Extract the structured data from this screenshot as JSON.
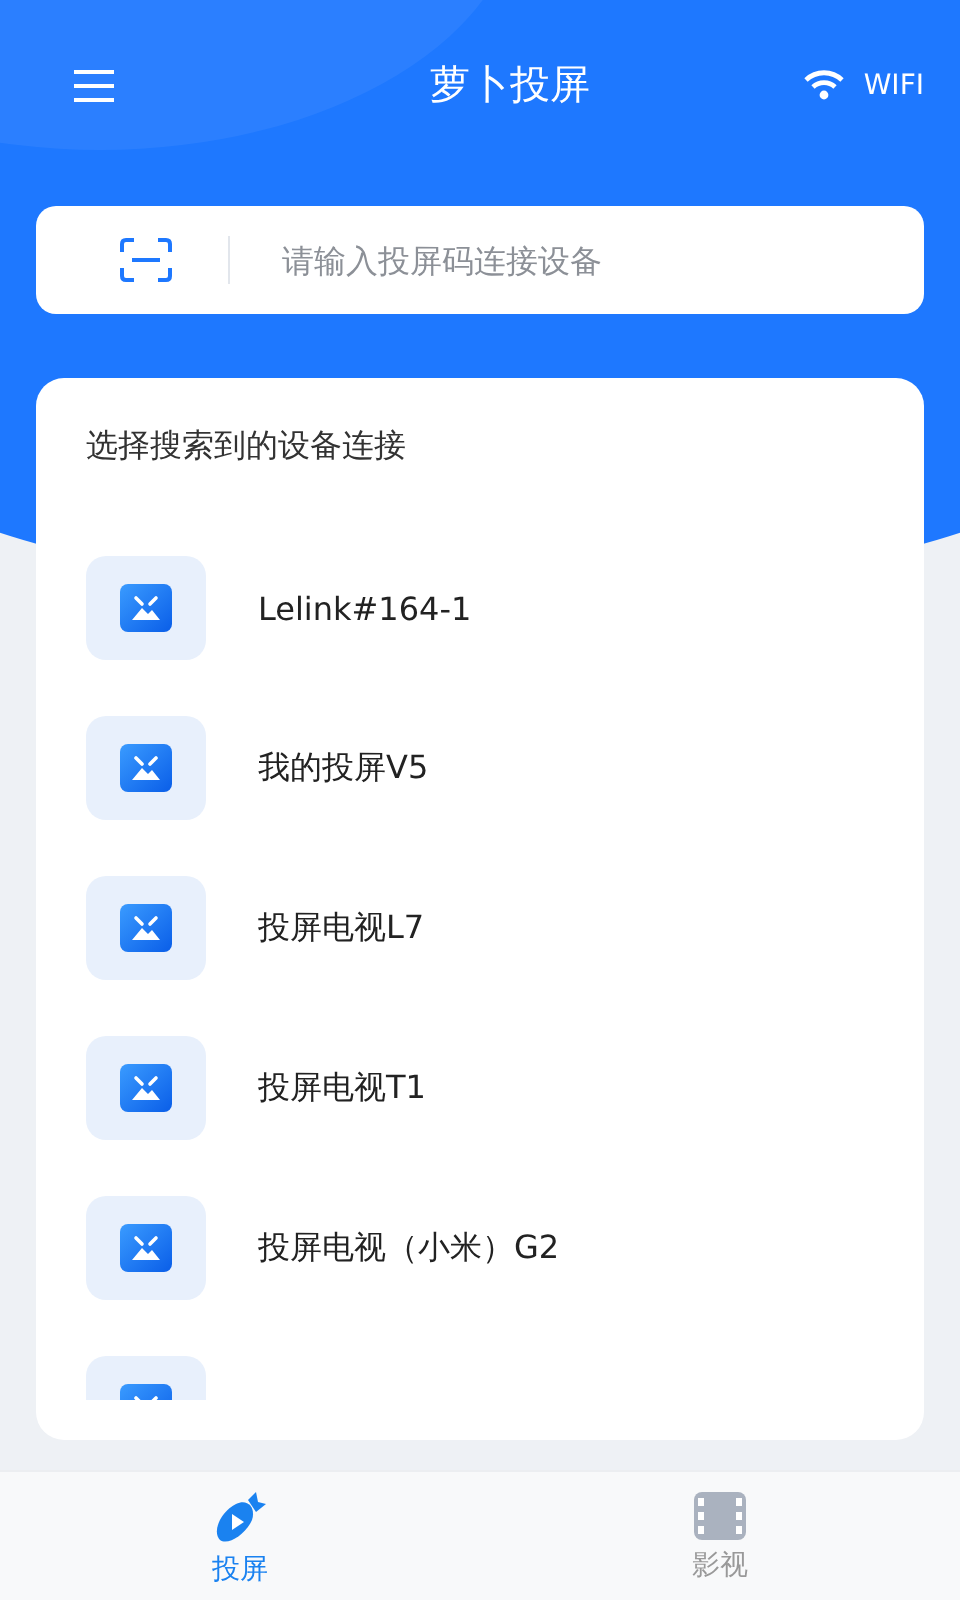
{
  "header": {
    "title": "萝卜投屏",
    "wifi_label": "WIFI"
  },
  "search": {
    "placeholder": "请输入投屏码连接设备"
  },
  "device_list": {
    "title": "选择搜索到的设备连接",
    "devices": [
      {
        "kind": "device",
        "name": "Lelink#164-1"
      },
      {
        "kind": "device",
        "name": "我的投屏V5"
      },
      {
        "kind": "device",
        "name": "投屏电视L7"
      },
      {
        "kind": "device",
        "name": "投屏电视T1"
      },
      {
        "kind": "device",
        "name": "投屏电视（小米）G2"
      },
      {
        "kind": "cutoff"
      }
    ]
  },
  "tabs": [
    {
      "kind": "cast",
      "label": "投屏",
      "selected": true
    },
    {
      "kind": "video",
      "label": "影视",
      "selected": false
    }
  ]
}
